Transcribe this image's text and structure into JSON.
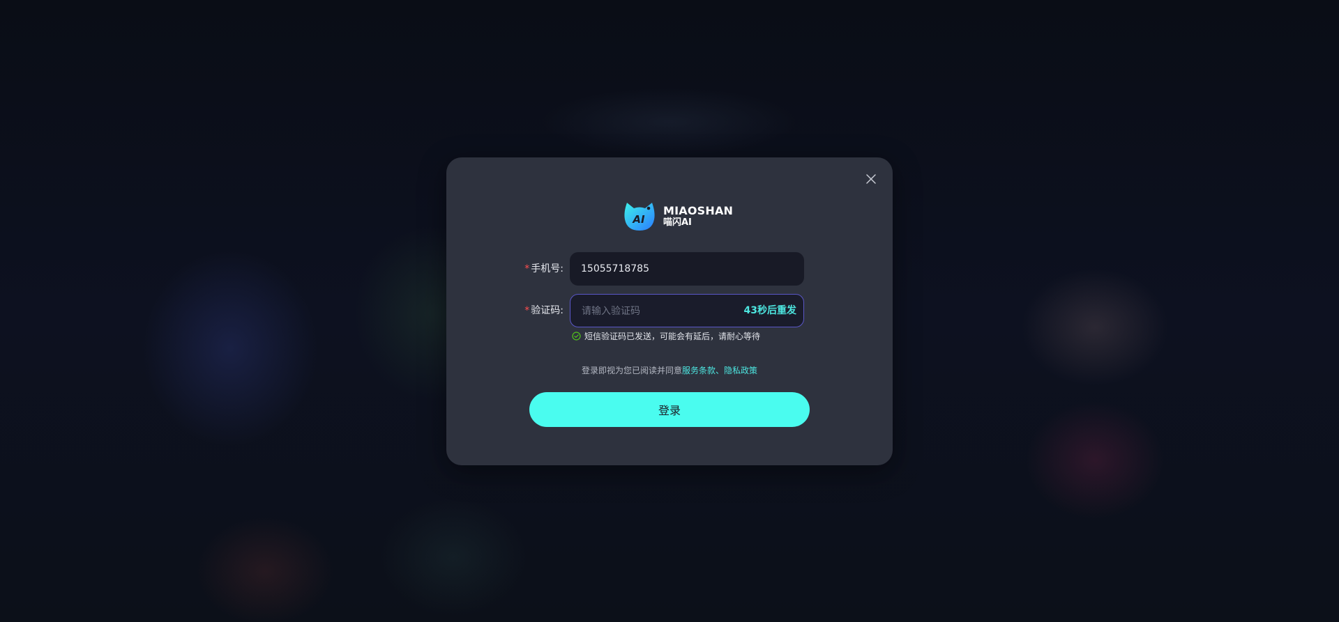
{
  "brand": {
    "name_en": "MIAOSHAN",
    "name_cn": "喵闪AI",
    "logo_mark": "AI"
  },
  "form": {
    "phone": {
      "required_mark": "*",
      "label": "手机号:",
      "value": "15055718785"
    },
    "code": {
      "required_mark": "*",
      "label": "验证码:",
      "placeholder": "请输入验证码",
      "value": "",
      "resend_label": "43秒后重发"
    },
    "hint": "短信验证码已发送，可能会有延后，请耐心等待",
    "agreement": {
      "prefix": "登录即视为您已阅读并同意",
      "terms": "服务条款",
      "separator": "、",
      "privacy": "隐私政策"
    },
    "submit_label": "登录"
  },
  "colors": {
    "accent": "#4afcef",
    "modal_bg": "#2e323e",
    "input_bg": "#181a26",
    "required": "#ff4d4f",
    "focus_border": "#5a57c8",
    "hint_icon": "#52c41a"
  },
  "icons": {
    "close": "close-icon",
    "hint": "check-circle-icon",
    "logo": "cat-logo-icon"
  }
}
